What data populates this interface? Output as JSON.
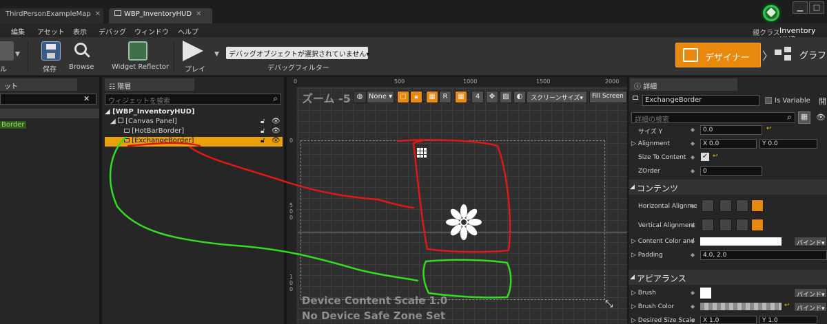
{
  "tabs": [
    {
      "label": "ThirdPersonExampleMap"
    },
    {
      "label": "WBP_InventoryHUD"
    }
  ],
  "menu": [
    "編集",
    "アセット",
    "表示",
    "デバッグ",
    "ウィンドウ",
    "ヘルプ"
  ],
  "parent_class": {
    "label": "親クラス",
    "value": "Inventory HUD"
  },
  "toolbar": {
    "left_label": "ル",
    "save": "保存",
    "browse": "Browse",
    "widget_reflector": "Widget Reflector",
    "play": "プレイ",
    "debug_object": "デバッグオブジェクトが選択されていません▾",
    "debug_filter": "デバッグフィルター",
    "designer": "デザイナー",
    "graph": "グラフ"
  },
  "left_panel": {
    "title": "ット",
    "close": "✕",
    "item": "Border"
  },
  "hierarchy": {
    "title": "階層",
    "search_placeholder": "ウィジェットを検索",
    "root": "[WBP_InventoryHUD]",
    "canvas": "[Canvas Panel]",
    "hotbar": "[HotBarBorder]",
    "exchange": "[ExchangeBorder]"
  },
  "viewport": {
    "zoom": "ズーム -5",
    "none": "None",
    "r": "R",
    "grid": "4",
    "screen_size": "スクリーンサイズ▾",
    "fill_screen": "Fill Screen",
    "ruler_top": [
      "0",
      "500",
      "1000",
      "1500",
      "2000"
    ],
    "ruler_left": [
      "0",
      "5 0 0",
      "1 0 0"
    ],
    "scale_text": "Device Content Scale 1.0",
    "safe_zone_text": "No Device Safe Zone Set"
  },
  "details": {
    "title": "詳細",
    "name_value": "ExchangeBorder",
    "is_variable": "Is Variable",
    "open": "開",
    "search_placeholder": "詳細の検索",
    "size_y": {
      "label": "サイズ Y",
      "value": "0.0"
    },
    "alignment": {
      "label": "Alignment",
      "x": "X 0.0",
      "y": "Y 0.0"
    },
    "size_to_content": "Size To Content",
    "zorder": {
      "label": "ZOrder",
      "value": "0"
    },
    "contents_header": "コンテンツ",
    "horizontal_alignment": "Horizontal Alignme",
    "vertical_alignment": "Vertical Alignment",
    "content_color": "Content Color and",
    "bind": "バインド▾",
    "padding": {
      "label": "Padding",
      "value": "4.0, 2.0"
    },
    "appearance_header": "アピアランス",
    "brush": "Brush",
    "brush_color": "Brush Color",
    "desired_size_scale": {
      "label": "Desired Size Scale",
      "x": "X 1.0",
      "y": "Y 1.0"
    }
  },
  "colors": {
    "accent": "#e8890d",
    "annotation_red": "#e01818",
    "annotation_green": "#33dd22"
  }
}
